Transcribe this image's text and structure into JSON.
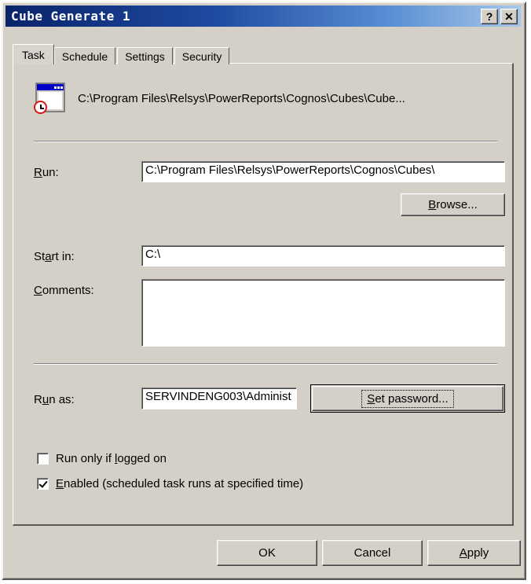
{
  "window": {
    "title": "Cube Generate 1",
    "help_button": "?",
    "close_button": "✕"
  },
  "tabs": [
    {
      "label": "Task",
      "selected": true
    },
    {
      "label": "Schedule",
      "selected": false
    },
    {
      "label": "Settings",
      "selected": false
    },
    {
      "label": "Security",
      "selected": false
    }
  ],
  "task": {
    "icon_name": "scheduled-task-icon",
    "path_display": "C:\\Program Files\\Relsys\\PowerReports\\Cognos\\Cubes\\Cube...",
    "run": {
      "label": "Run:",
      "label_accel": "R",
      "value": "C:\\Program Files\\Relsys\\PowerReports\\Cognos\\Cubes\\"
    },
    "browse_button": {
      "label": "Browse...",
      "accel": "B"
    },
    "start_in": {
      "label": "Start in:",
      "accel": "a",
      "value": "C:\\"
    },
    "comments": {
      "label": "Comments:",
      "accel": "C",
      "value": ""
    },
    "run_as": {
      "label": "Run as:",
      "accel": "u",
      "value": "SERVINDENG003\\Administ"
    },
    "set_password_button": {
      "label": "Set password...",
      "accel": "S"
    },
    "checkboxes": [
      {
        "label": "Run only if logged on",
        "accel": "l",
        "checked": false
      },
      {
        "label": "Enabled (scheduled task runs at specified time)",
        "accel": "E",
        "checked": true
      }
    ]
  },
  "footer": {
    "ok": "OK",
    "cancel": "Cancel",
    "apply": "Apply",
    "apply_accel": "A"
  },
  "colors": {
    "dialog_face": "#d4d0c8",
    "titlebar_start": "#0a246a",
    "titlebar_end": "#a6c8ea",
    "field_bg": "#ffffff",
    "text": "#000000",
    "icon_titlebar_blue": "#0000c8",
    "icon_clock_red": "#d81818"
  }
}
